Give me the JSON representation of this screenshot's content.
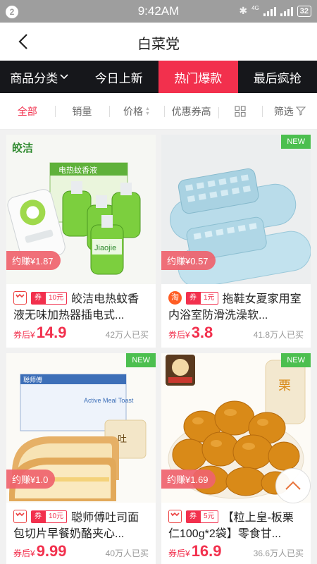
{
  "status_bar": {
    "notification_count": "2",
    "time": "9:42AM",
    "battery": "32",
    "network": "4G"
  },
  "header": {
    "title": "白菜党"
  },
  "category_tabs": [
    {
      "label": "商品分类"
    },
    {
      "label": "今日上新"
    },
    {
      "label": "热门爆款",
      "active": true
    },
    {
      "label": "最后疯抢"
    }
  ],
  "filters": {
    "all": "全部",
    "sales": "销量",
    "price": "价格",
    "coupon_high": "优惠券高",
    "filter": "筛选"
  },
  "colors": {
    "accent": "#f2304d",
    "dark_tab_bar": "#16171b",
    "new_badge": "#4cbf4f"
  },
  "products": [
    {
      "earn": "约赚¥1.87",
      "source": "tmall",
      "coupon_label": "券",
      "coupon_value": "10元",
      "title": "皎洁电热蚊香液无味加热器插电式...",
      "price_label": "券后¥",
      "price": "14.9",
      "sold": "42万人已买",
      "is_new": false,
      "image_brand": "皎洁",
      "image_box_label": "电热蚊香液",
      "image_bottle_label": "Jiaojie"
    },
    {
      "earn": "约赚¥0.57",
      "source": "taobao",
      "source_label": "淘",
      "coupon_label": "券",
      "coupon_value": "1元",
      "title": "拖鞋女夏家用室内浴室防滑洗澡软...",
      "price_label": "券后¥",
      "price": "3.8",
      "sold": "41.8万人已买",
      "is_new": true,
      "new_label": "NEW"
    },
    {
      "earn": "约赚¥1.0",
      "source": "tmall",
      "coupon_label": "券",
      "coupon_value": "10元",
      "title": "聪师傅吐司面包切片早餐奶酪夹心...",
      "price_label": "券后¥",
      "price": "9.99",
      "sold": "40万人已买",
      "is_new": true,
      "new_label": "NEW",
      "image_box_text": "Active Meal Toast",
      "image_box_brand": "聪师傅",
      "image_pack_text": "吐"
    },
    {
      "earn": "约赚¥1.69",
      "source": "tmall",
      "coupon_label": "券",
      "coupon_value": "5元",
      "title": "【粒上皇-板栗仁100g*2袋】零食甘...",
      "price_label": "券后¥",
      "price": "16.9",
      "sold": "36.6万人已买",
      "is_new": true,
      "new_label": "NEW",
      "image_bag_text": "栗"
    }
  ]
}
